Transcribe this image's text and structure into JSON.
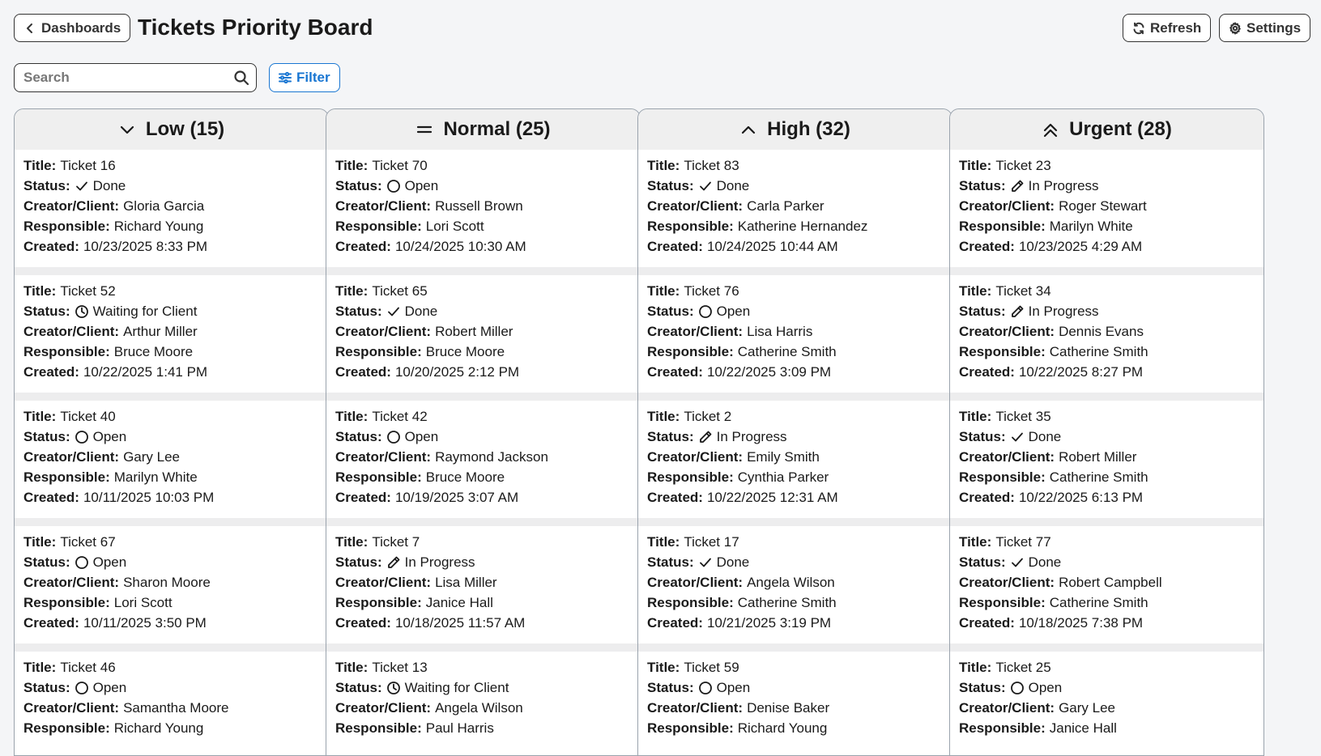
{
  "header": {
    "back_label": "Dashboards",
    "title": "Tickets Priority Board",
    "refresh_label": "Refresh",
    "settings_label": "Settings"
  },
  "toolbar": {
    "search_placeholder": "Search",
    "filter_label": "Filter"
  },
  "labels": {
    "title": "Title:",
    "status": "Status:",
    "creator": "Creator/Client:",
    "responsible": "Responsible:",
    "created": "Created:"
  },
  "columns": [
    {
      "icon": "chevron-down-icon",
      "label": "Low (15)",
      "cards": [
        {
          "title": "Ticket 16",
          "status": "Done",
          "status_icon": "check-icon",
          "creator": "Gloria Garcia",
          "responsible": "Richard Young",
          "created": "10/23/2025 8:33 PM"
        },
        {
          "title": "Ticket 52",
          "status": "Waiting for Client",
          "status_icon": "clock-icon",
          "creator": "Arthur Miller",
          "responsible": "Bruce Moore",
          "created": "10/22/2025 1:41 PM"
        },
        {
          "title": "Ticket 40",
          "status": "Open",
          "status_icon": "circle-icon",
          "creator": "Gary Lee",
          "responsible": "Marilyn White",
          "created": "10/11/2025 10:03 PM"
        },
        {
          "title": "Ticket 67",
          "status": "Open",
          "status_icon": "circle-icon",
          "creator": "Sharon Moore",
          "responsible": "Lori Scott",
          "created": "10/11/2025 3:50 PM"
        },
        {
          "title": "Ticket 46",
          "status": "Open",
          "status_icon": "circle-icon",
          "creator": "Samantha Moore",
          "responsible": "Richard Young",
          "created": ""
        }
      ]
    },
    {
      "icon": "equals-icon",
      "label": "Normal (25)",
      "cards": [
        {
          "title": "Ticket 70",
          "status": "Open",
          "status_icon": "circle-icon",
          "creator": "Russell Brown",
          "responsible": "Lori Scott",
          "created": "10/24/2025 10:30 AM"
        },
        {
          "title": "Ticket 65",
          "status": "Done",
          "status_icon": "check-icon",
          "creator": "Robert Miller",
          "responsible": "Bruce Moore",
          "created": "10/20/2025 2:12 PM"
        },
        {
          "title": "Ticket 42",
          "status": "Open",
          "status_icon": "circle-icon",
          "creator": "Raymond Jackson",
          "responsible": "Bruce Moore",
          "created": "10/19/2025 3:07 AM"
        },
        {
          "title": "Ticket 7",
          "status": "In Progress",
          "status_icon": "pencil-icon",
          "creator": "Lisa Miller",
          "responsible": "Janice Hall",
          "created": "10/18/2025 11:57 AM"
        },
        {
          "title": "Ticket 13",
          "status": "Waiting for Client",
          "status_icon": "clock-icon",
          "creator": "Angela Wilson",
          "responsible": "Paul Harris",
          "created": ""
        }
      ]
    },
    {
      "icon": "chevron-up-icon",
      "label": "High (32)",
      "cards": [
        {
          "title": "Ticket 83",
          "status": "Done",
          "status_icon": "check-icon",
          "creator": "Carla Parker",
          "responsible": "Katherine Hernandez",
          "created": "10/24/2025 10:44 AM"
        },
        {
          "title": "Ticket 76",
          "status": "Open",
          "status_icon": "circle-icon",
          "creator": "Lisa Harris",
          "responsible": "Catherine Smith",
          "created": "10/22/2025 3:09 PM"
        },
        {
          "title": "Ticket 2",
          "status": "In Progress",
          "status_icon": "pencil-icon",
          "creator": "Emily Smith",
          "responsible": "Cynthia Parker",
          "created": "10/22/2025 12:31 AM"
        },
        {
          "title": "Ticket 17",
          "status": "Done",
          "status_icon": "check-icon",
          "creator": "Angela Wilson",
          "responsible": "Catherine Smith",
          "created": "10/21/2025 3:19 PM"
        },
        {
          "title": "Ticket 59",
          "status": "Open",
          "status_icon": "circle-icon",
          "creator": "Denise Baker",
          "responsible": "Richard Young",
          "created": ""
        }
      ]
    },
    {
      "icon": "double-chevron-up-icon",
      "label": "Urgent (28)",
      "cards": [
        {
          "title": "Ticket 23",
          "status": "In Progress",
          "status_icon": "pencil-icon",
          "creator": "Roger Stewart",
          "responsible": "Marilyn White",
          "created": "10/23/2025 4:29 AM"
        },
        {
          "title": "Ticket 34",
          "status": "In Progress",
          "status_icon": "pencil-icon",
          "creator": "Dennis Evans",
          "responsible": "Catherine Smith",
          "created": "10/22/2025 8:27 PM"
        },
        {
          "title": "Ticket 35",
          "status": "Done",
          "status_icon": "check-icon",
          "creator": "Robert Miller",
          "responsible": "Catherine Smith",
          "created": "10/22/2025 6:13 PM"
        },
        {
          "title": "Ticket 77",
          "status": "Done",
          "status_icon": "check-icon",
          "creator": "Robert Campbell",
          "responsible": "Catherine Smith",
          "created": "10/18/2025 7:38 PM"
        },
        {
          "title": "Ticket 25",
          "status": "Open",
          "status_icon": "circle-icon",
          "creator": "Gary Lee",
          "responsible": "Janice Hall",
          "created": ""
        }
      ]
    }
  ],
  "colors": {
    "accent": "#1976d2",
    "background": "#f4f5f7",
    "border": "#9aa3ad"
  }
}
